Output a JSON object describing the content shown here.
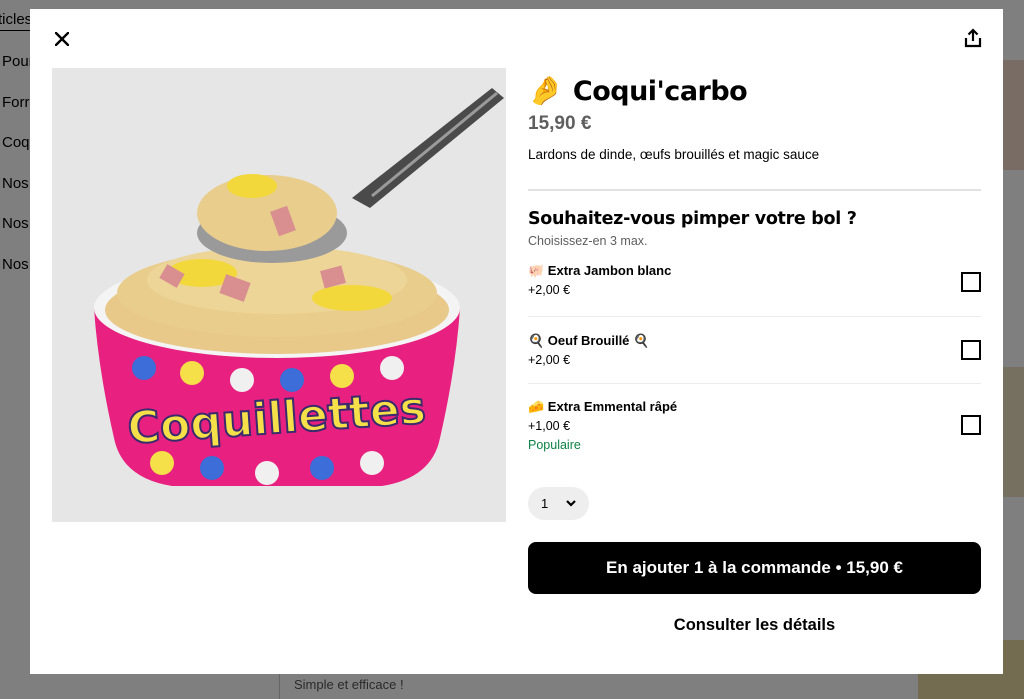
{
  "background": {
    "nav_items": [
      "ticles",
      "Pour",
      "Forr",
      "Coq",
      "Nos",
      "Nos",
      "Nos"
    ],
    "bottom_text": "Simple et efficace !"
  },
  "modal": {
    "close_icon": "close-icon",
    "share_icon": "share-icon",
    "product": {
      "emoji": "🤌",
      "name": "Coqui'carbo",
      "price": "15,90 €",
      "description": "Lardons de dinde, œufs brouillés et magic sauce"
    },
    "options_section": {
      "title": "Souhaitez-vous pimper votre bol ?",
      "subtitle": "Choisissez-en 3 max.",
      "items": [
        {
          "label": "🐖 Extra Jambon blanc",
          "price": "+2,00 €",
          "tag": ""
        },
        {
          "label": "🍳 Oeuf Brouillé 🍳",
          "price": "+2,00 €",
          "tag": ""
        },
        {
          "label": "🧀 Extra Emmental râpé",
          "price": "+1,00 €",
          "tag": "Populaire"
        }
      ]
    },
    "quantity": "1",
    "add_button": "En ajouter 1 à la commande • 15,90 €",
    "details_link": "Consulter les détails",
    "image_text": "Coquillettes",
    "colors": {
      "accent_green": "#0e8345",
      "cup_pink": "#e8207f",
      "button_black": "#000000"
    }
  }
}
